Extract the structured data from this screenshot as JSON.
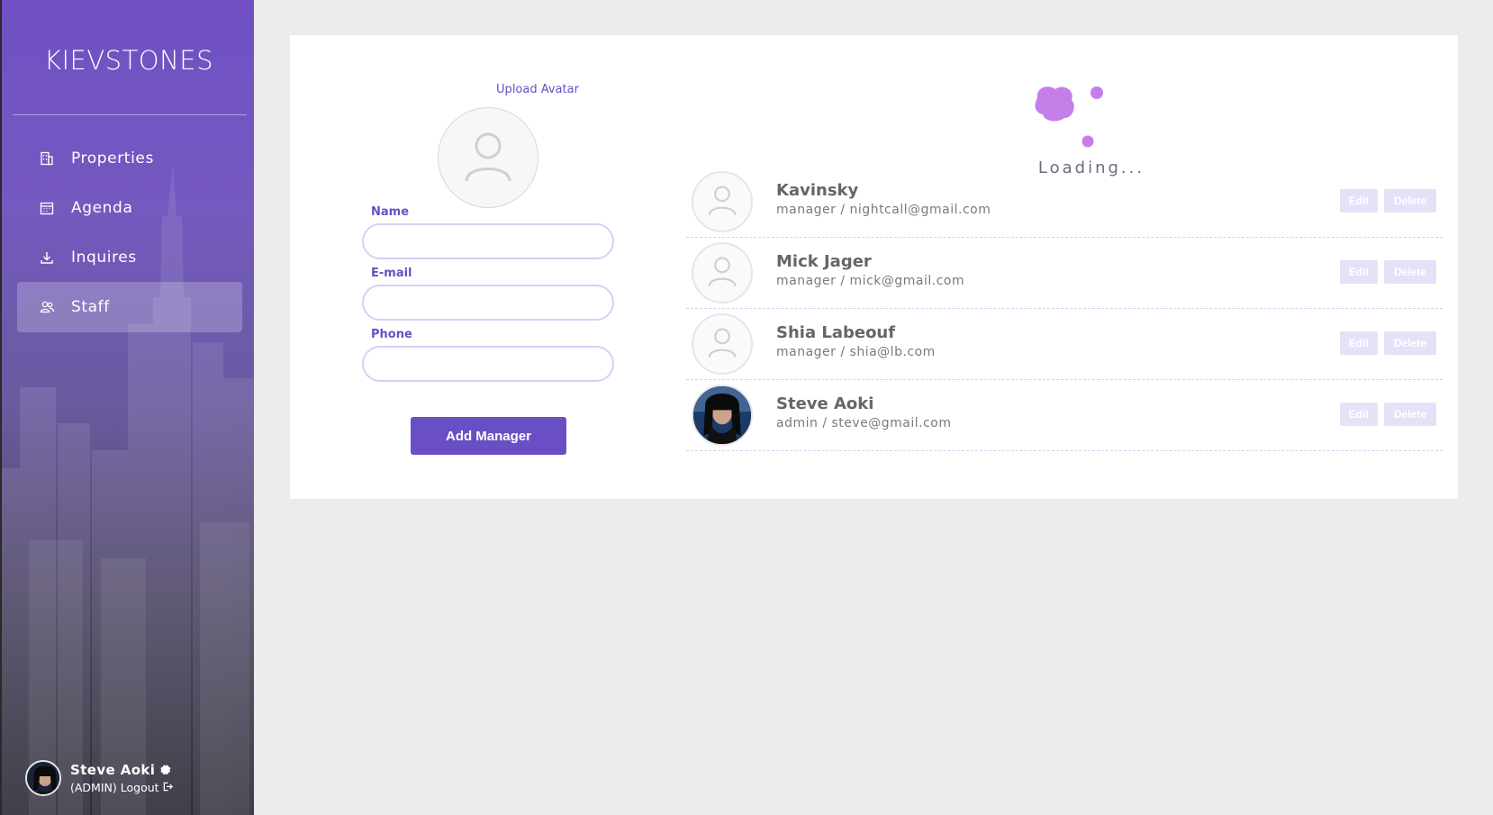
{
  "sidebar": {
    "brand": "KIEVSTONES",
    "items": [
      {
        "label": "Properties",
        "icon": "building-icon",
        "active": false
      },
      {
        "label": "Agenda",
        "icon": "calendar-icon",
        "active": false
      },
      {
        "label": "Inquires",
        "icon": "download-icon",
        "active": false
      },
      {
        "label": "Staff",
        "icon": "users-icon",
        "active": true
      }
    ],
    "user": {
      "name": "Steve Aoki",
      "role": "(ADMIN)",
      "logout_label": "Logout"
    }
  },
  "form": {
    "upload_avatar_label": "Upload Avatar",
    "name_label": "Name",
    "name_value": "",
    "email_label": "E-mail",
    "email_value": "",
    "phone_label": "Phone",
    "phone_value": "",
    "submit_label": "Add Manager"
  },
  "loading": {
    "text": "Loading..."
  },
  "staff": [
    {
      "name": "Kavinsky",
      "role": "manager",
      "email": "nightcall@gmail.com",
      "sub": "manager / nightcall@gmail.com",
      "has_photo": false
    },
    {
      "name": "Mick Jager",
      "role": "manager",
      "email": "mick@gmail.com",
      "sub": "manager / mick@gmail.com",
      "has_photo": false
    },
    {
      "name": "Shia Labeouf",
      "role": "manager",
      "email": "shia@lb.com",
      "sub": "manager / shia@lb.com",
      "has_photo": false
    },
    {
      "name": "Steve Aoki",
      "role": "admin",
      "email": "steve@gmail.com",
      "sub": "admin / steve@gmail.com",
      "has_photo": true
    }
  ],
  "row_actions": {
    "edit_label": "Edit",
    "delete_label": "Delete"
  },
  "colors": {
    "accent": "#6a4fc4",
    "loader": "#c57ee8",
    "disabled_button": "#e6e1f7"
  }
}
